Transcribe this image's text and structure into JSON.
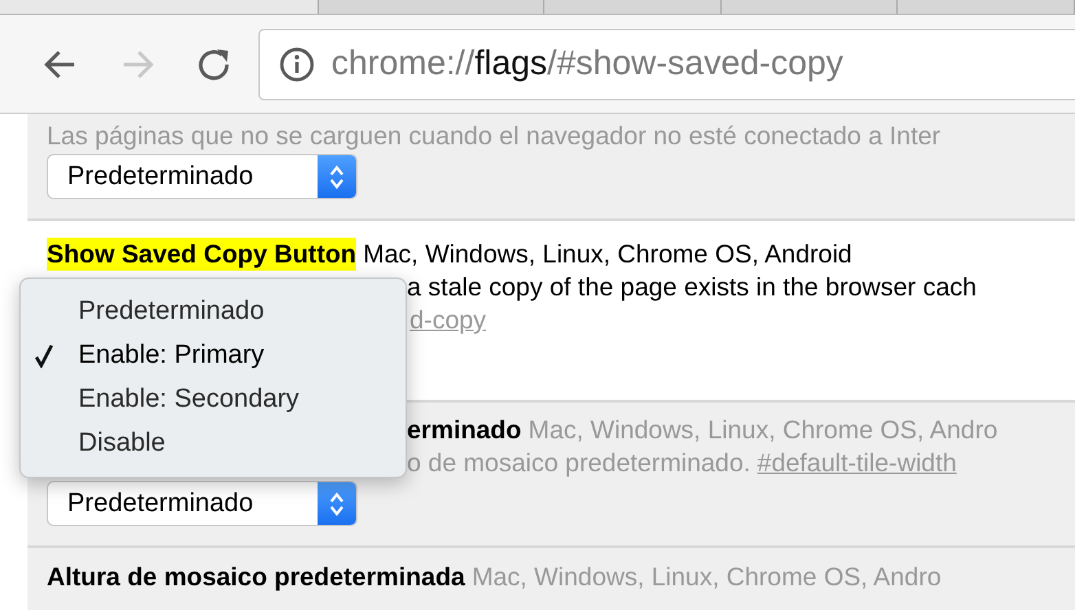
{
  "toolbar": {
    "back": {
      "disabled": false
    },
    "forward": {
      "disabled": true
    },
    "url": {
      "prefix": "chrome://",
      "host": "flags",
      "suffix": "/#show-saved-copy"
    }
  },
  "experiments": [
    {
      "highlighted": false,
      "description": "Las páginas que no se carguen cuando el navegador no esté conectado a Inter",
      "select": "Predeterminado"
    },
    {
      "highlighted": true,
      "name": "Show Saved Copy Button",
      "platforms": "Mac, Windows, Linux, Chrome OS, Android",
      "text_covered": true,
      "description": "a stale copy of the page exists in the browser cach",
      "link": "d-copy",
      "link_covered": true
    },
    {
      "highlighted": false,
      "name_covered": true,
      "name": "erminado",
      "platforms": "Mac, Windows, Linux, Chrome OS, Andro",
      "text_covered": true,
      "description": "o de mosaico predeterminado.",
      "link": "#default-tile-width",
      "select": "Predeterminado"
    },
    {
      "highlighted": false,
      "name": "Altura de mosaico predeterminada",
      "platforms": "Mac, Windows, Linux, Chrome OS, Andro"
    }
  ],
  "menu": {
    "items": [
      {
        "label": "Predeterminado",
        "selected": false
      },
      {
        "label": "Enable: Primary",
        "selected": true
      },
      {
        "label": "Enable: Secondary",
        "selected": false
      },
      {
        "label": "Disable",
        "selected": false
      }
    ]
  }
}
